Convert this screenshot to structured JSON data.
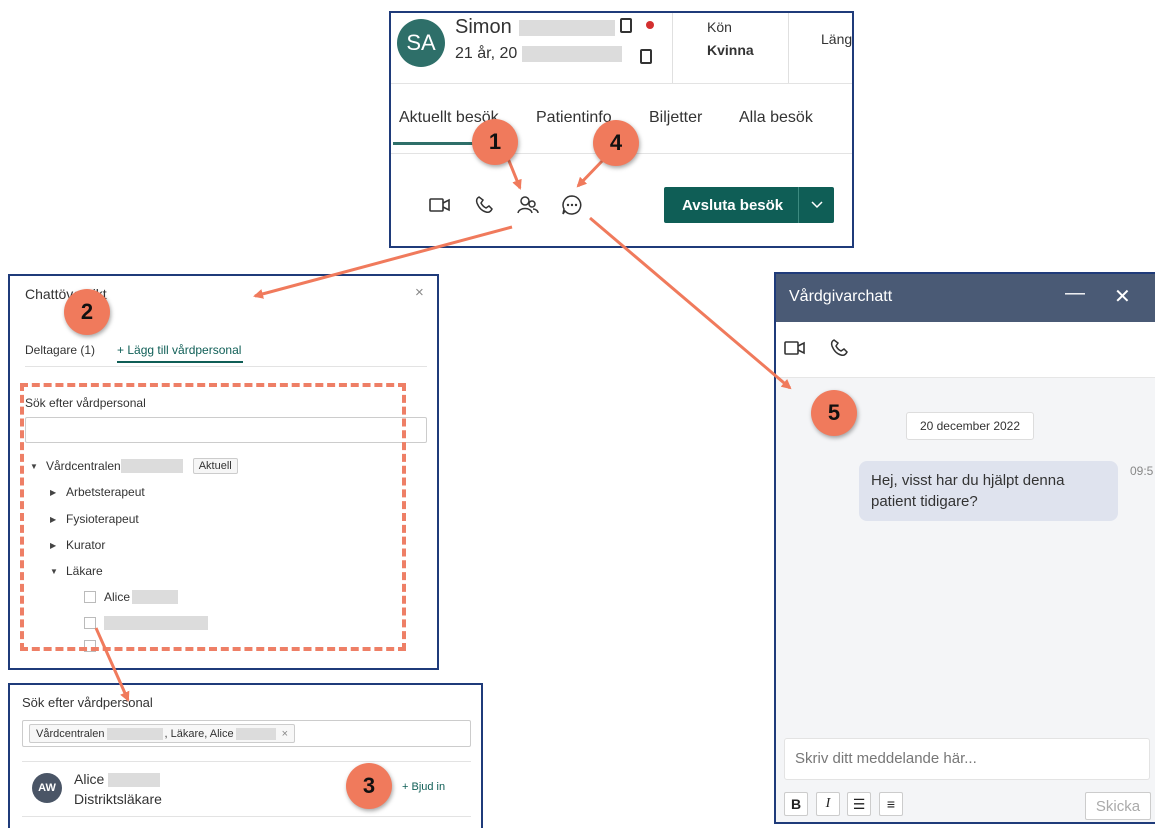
{
  "patient": {
    "avatar_initials": "SA",
    "name": "Simon",
    "age_info": "21 år, 20",
    "gender_label": "Kön",
    "gender_value": "Kvinna",
    "length_label": "Läng",
    "tabs": [
      "Aktuellt besök",
      "Patientinfo",
      "Biljetter",
      "Alla besök"
    ],
    "end_visit_label": "Avsluta besök",
    "tool_icons": [
      "video-icon",
      "phone-icon",
      "participants-icon",
      "chat-icon"
    ]
  },
  "overview": {
    "title": "Chattöversikt",
    "close": "×",
    "tab_participants": "Deltagare (1)",
    "tab_add": "+ Lägg till vårdpersonal",
    "search_label": "Sök efter vårdpersonal",
    "tree": {
      "root": "Vårdcentralen",
      "root_badge": "Aktuell",
      "groups": [
        "Arbetsterapeut",
        "Fysioterapeut",
        "Kurator",
        "Läkare"
      ],
      "doctor": "Alice"
    }
  },
  "search_result": {
    "label": "Sök efter vårdpersonal",
    "chip_part1": "Vårdcentralen",
    "chip_part2": ", Läkare, Alice",
    "chip_remove": "×",
    "avatar_initials": "AW",
    "name": "Alice",
    "role": "Distriktsläkare",
    "invite_label": "+ Bjud in"
  },
  "chat": {
    "title": "Vårdgivarchatt",
    "minimize": "—",
    "close": "✕",
    "date": "20 december 2022",
    "message": "Hej, visst har du hjälpt denna patient tidigare?",
    "time": "09:5",
    "input_placeholder": "Skriv ditt meddelande här...",
    "format_buttons": [
      "B",
      "I",
      "☰",
      "≡"
    ],
    "send_label": "Skicka"
  },
  "annotations": [
    "1",
    "2",
    "3",
    "4",
    "5"
  ],
  "colors": {
    "brand_green": "#0f5e56",
    "annotation": "#f07a5c",
    "frame": "#1f3b7a",
    "chat_header": "#4a5a75"
  }
}
